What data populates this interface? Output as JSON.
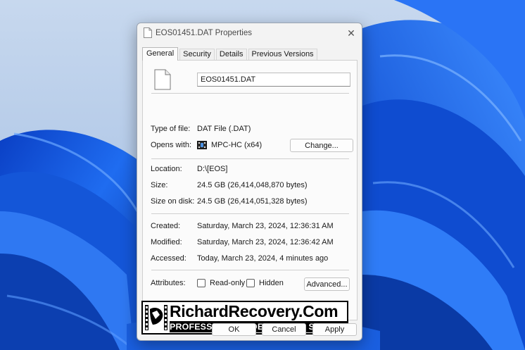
{
  "dialog": {
    "title": "EOS01451.DAT Properties",
    "close_glyph": "✕"
  },
  "tabs": [
    {
      "label": "General",
      "active": true
    },
    {
      "label": "Security"
    },
    {
      "label": "Details"
    },
    {
      "label": "Previous Versions"
    }
  ],
  "general": {
    "filename": "EOS01451.DAT",
    "type_label": "Type of file:",
    "type_value": "DAT File (.DAT)",
    "opens_label": "Opens with:",
    "opens_value": "MPC-HC (x64)",
    "change_button": "Change...",
    "location_label": "Location:",
    "location_value": "D:\\[EOS]",
    "size_label": "Size:",
    "size_value": "24.5 GB (26,414,048,870 bytes)",
    "size_disk_label": "Size on disk:",
    "size_disk_value": "24.5 GB (26,414,051,328 bytes)",
    "created_label": "Created:",
    "created_value": "Saturday, March 23, 2024, 12:36:31 AM",
    "modified_label": "Modified:",
    "modified_value": "Saturday, March 23, 2024, 12:36:42 AM",
    "accessed_label": "Accessed:",
    "accessed_value": "Today, March 23, 2024, 4 minutes ago",
    "attributes_label": "Attributes:",
    "readonly_label": "Read-only",
    "readonly_checked": false,
    "hidden_label": "Hidden",
    "hidden_checked": false,
    "advanced_button": "Advanced..."
  },
  "watermark": {
    "main": "RichardRecovery.Com",
    "sub": "PROFESSIONAL VIDEO REPAIR SERVICE"
  },
  "footer": {
    "ok": "OK",
    "cancel": "Cancel",
    "apply": "Apply"
  },
  "icons": {
    "file": "blank-file-icon",
    "app": "mpc-hc-app-icon",
    "close": "close-icon"
  },
  "colors": {
    "wallpaper_blue": "#1a5fe0",
    "wallpaper_bg": "#a9c4e6",
    "dialog_bg": "#f3f3f3"
  }
}
